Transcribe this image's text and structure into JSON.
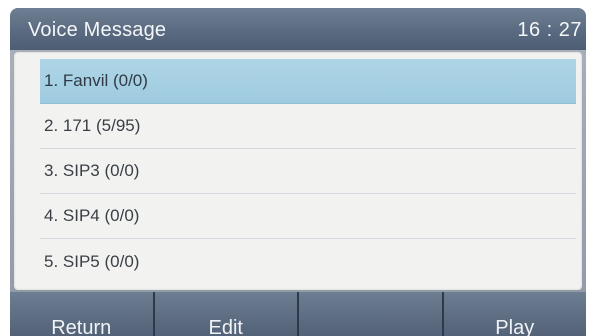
{
  "header": {
    "title": "Voice Message",
    "clock": "16 : 27"
  },
  "list": {
    "items": [
      {
        "label": "1. Fanvil  (0/0)",
        "selected": true
      },
      {
        "label": "2. 171  (5/95)",
        "selected": false
      },
      {
        "label": "3. SIP3  (0/0)",
        "selected": false
      },
      {
        "label": "4. SIP4  (0/0)",
        "selected": false
      },
      {
        "label": "5. SIP5  (0/0)",
        "selected": false
      }
    ]
  },
  "softkeys": {
    "key1": "Return",
    "key2": "Edit",
    "key3": "",
    "key4": "Play"
  },
  "colors": {
    "titlebar": "#5a6a80",
    "selection": "#a8d1e4",
    "list_background": "#f2f3f1",
    "softkey_bar": "#4e5d72"
  }
}
